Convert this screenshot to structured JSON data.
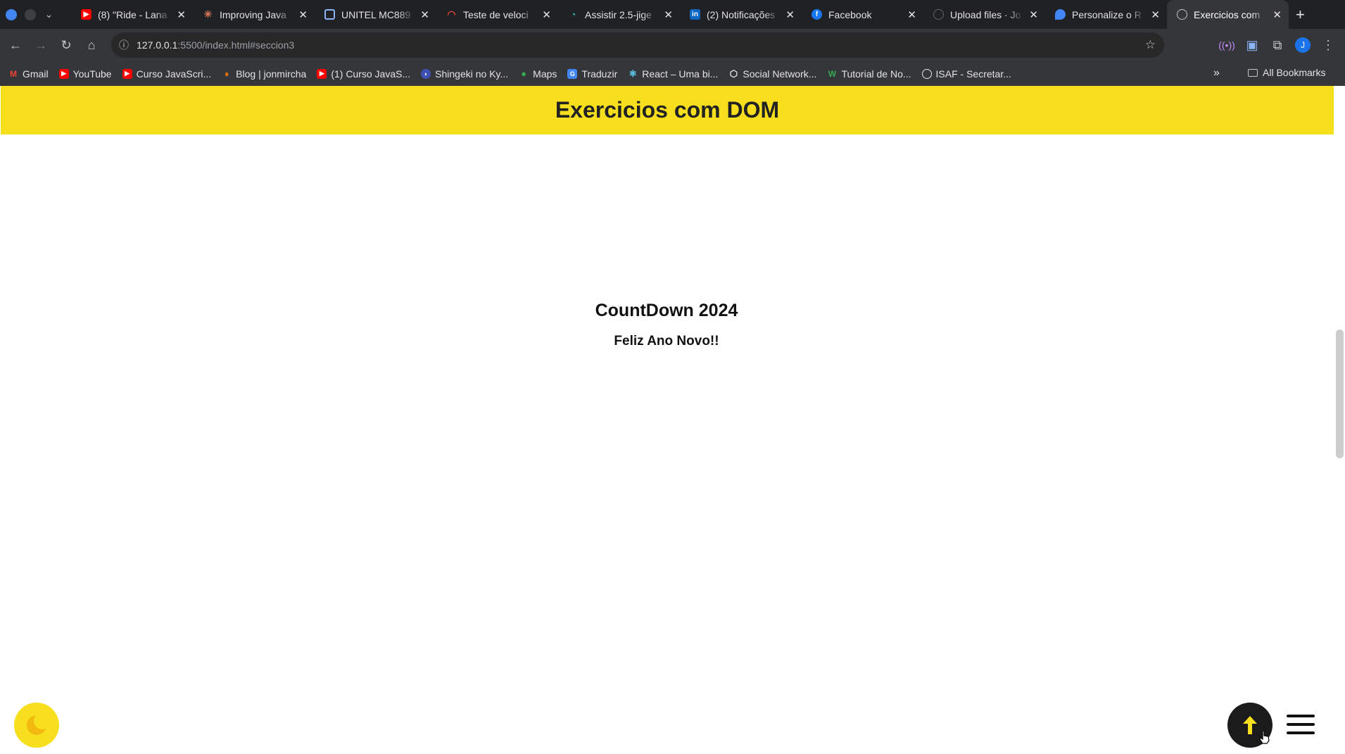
{
  "browser": {
    "tabs": [
      {
        "title": "(8) \"Ride - Lana",
        "favicon": "youtube-icon",
        "color": "#ff0000"
      },
      {
        "title": "Improving Java",
        "favicon": "claude-icon",
        "color": "#d97757"
      },
      {
        "title": "UNITEL MC889",
        "favicon": "router-icon",
        "color": "#8ab4f8"
      },
      {
        "title": "Teste de veloci",
        "favicon": "speedtest-icon",
        "color": "#e8453c"
      },
      {
        "title": "Assistir 2.5-jige",
        "favicon": "anime-icon",
        "color": "#3fb8af"
      },
      {
        "title": "(2) Notificações",
        "favicon": "linkedin-icon",
        "color": "#0a66c2"
      },
      {
        "title": "Facebook",
        "favicon": "facebook-icon",
        "color": "#1877f2"
      },
      {
        "title": "Upload files · Jo",
        "favicon": "github-icon",
        "color": "#35363a"
      },
      {
        "title": "Personalize o R",
        "favicon": "drop-icon",
        "color": "#4285f4"
      },
      {
        "title": "Exercicios com",
        "favicon": "globe-icon",
        "color": "#9aa0a6"
      }
    ],
    "url_host": "127.0.0.1",
    "url_rest": ":5500/index.html#seccion3",
    "avatar_letter": "J",
    "bookmarks": [
      {
        "label": "Gmail",
        "icon": "gmail-icon",
        "color": "#ea4335"
      },
      {
        "label": "YouTube",
        "icon": "youtube-icon",
        "color": "#ff0000"
      },
      {
        "label": "Curso JavaScri...",
        "icon": "youtube-icon",
        "color": "#ff0000"
      },
      {
        "label": "Blog | jonmircha",
        "icon": "blog-icon",
        "color": "#e8710a"
      },
      {
        "label": "(1) Curso JavaS...",
        "icon": "youtube-icon",
        "color": "#ff0000"
      },
      {
        "label": "Shingeki no Ky...",
        "icon": "anime-icon",
        "color": "#3f51b5"
      },
      {
        "label": "Maps",
        "icon": "maps-icon",
        "color": "#34a853"
      },
      {
        "label": "Traduzir",
        "icon": "translate-icon",
        "color": "#4285f4"
      },
      {
        "label": "React – Uma bi...",
        "icon": "react-icon",
        "color": "#61dafb"
      },
      {
        "label": "Social Network...",
        "icon": "network-icon",
        "color": "#e3e3e3"
      },
      {
        "label": "Tutorial de No...",
        "icon": "w-icon",
        "color": "#34a853"
      },
      {
        "label": "ISAF - Secretar...",
        "icon": "globe-icon",
        "color": "#e3e3e3"
      }
    ],
    "all_bookmarks": "All Bookmarks"
  },
  "page": {
    "header_title": "Exercicios com DOM",
    "countdown_title": "CountDown 2024",
    "countdown_message": "Feliz Ano Novo!!"
  },
  "colors": {
    "accent": "#f7df1e",
    "dark": "#1b1b1b"
  }
}
